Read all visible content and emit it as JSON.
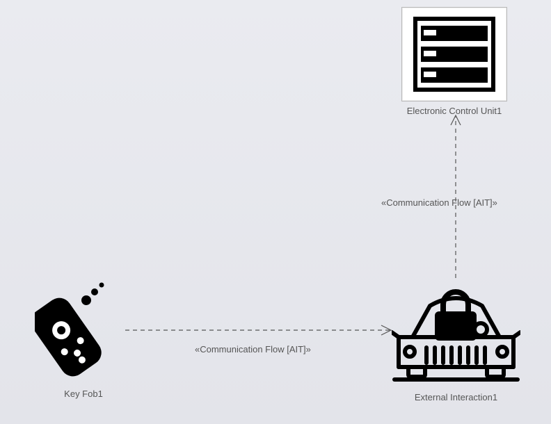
{
  "diagram": {
    "nodes": {
      "ecu": {
        "label": "Electronic Control Unit1",
        "icon": "server-rack-icon"
      },
      "keyfob": {
        "label": "Key Fob1",
        "icon": "remote-keyfob-icon"
      },
      "car": {
        "label": "External Interaction1",
        "icon": "car-lock-icon"
      }
    },
    "edges": {
      "keyfob_to_car": {
        "label": "«Communication Flow [AIT]»"
      },
      "car_to_ecu": {
        "label": "«Communication Flow [AIT]»"
      }
    }
  }
}
